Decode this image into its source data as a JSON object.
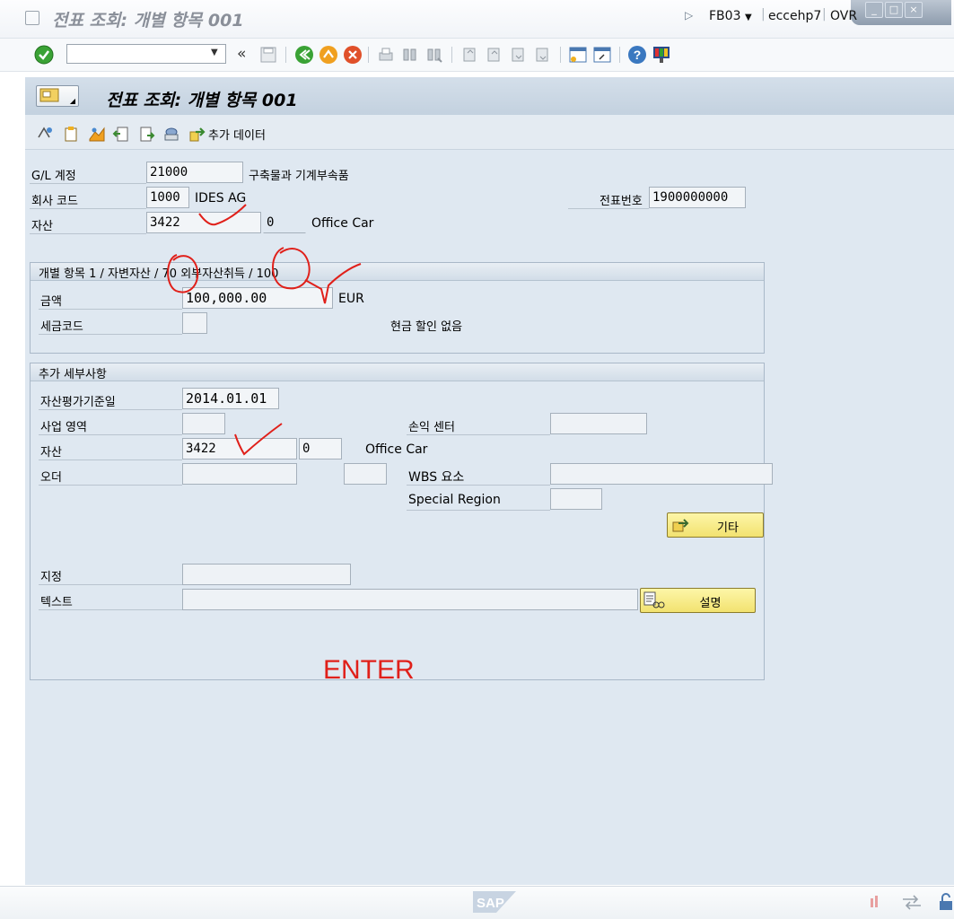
{
  "window": {
    "title": "전표 조회: 개별 항목 001",
    "controls": [
      "_",
      "□",
      "×"
    ]
  },
  "toolbar": {
    "command_value": "",
    "expand_symbol": "«"
  },
  "screen": {
    "title": "전표 조회: 개별 항목 001"
  },
  "app_toolbar": {
    "extra_data_label": "추가 데이터"
  },
  "header_fields": {
    "gl_account": {
      "label": "G/L 계정",
      "value": "21000",
      "text": "구축물과 기계부속품"
    },
    "company_code": {
      "label": "회사 코드",
      "value": "1000",
      "text": "IDES AG"
    },
    "doc_number": {
      "label": "전표번호",
      "value": "1900000000"
    },
    "asset": {
      "label": "자산",
      "value": "3422",
      "sub": "0",
      "text": "Office Car"
    }
  },
  "line_item": {
    "title_prefix": "개별 항목 1 / 자변자산 /",
    "posting_key": "70",
    "title_mid": "외부자산취득",
    "slash": "/",
    "trans_type": "100",
    "amount": {
      "label": "금액",
      "value": "100,000.00",
      "currency": "EUR"
    },
    "tax_code": {
      "label": "세금코드",
      "value": "",
      "text": "현금 할인 없음"
    }
  },
  "additional": {
    "title": "추가 세부사항",
    "value_date": {
      "label": "자산평가기준일",
      "value": "2014.01.01"
    },
    "business_area": {
      "label": "사업 영역",
      "value": ""
    },
    "profit_center": {
      "label": "손익 센터",
      "value": ""
    },
    "asset": {
      "label": "자산",
      "value": "3422",
      "sub": "0",
      "text": "Office Car"
    },
    "order": {
      "label": "오더",
      "value": "",
      "value2": ""
    },
    "wbs": {
      "label": "WBS 요소",
      "value": ""
    },
    "special_region": {
      "label": "Special Region",
      "value": ""
    },
    "more_button": "기타",
    "assignment": {
      "label": "지정",
      "value": ""
    },
    "text": {
      "label": "텍스트",
      "value": ""
    },
    "describe_button": "설명"
  },
  "annotation": {
    "text": "ENTER",
    "color": "#e0201a"
  },
  "status_bar": {
    "tcode": "FB03",
    "system": "eccehp7",
    "mode": "OVR"
  },
  "colors": {
    "accent_yellow": "#f2e270",
    "screen_bg": "#dfe8f1",
    "header_bg": "#c3d1df",
    "ok_green": "#3aa235",
    "annotation_red": "#e0201a"
  }
}
